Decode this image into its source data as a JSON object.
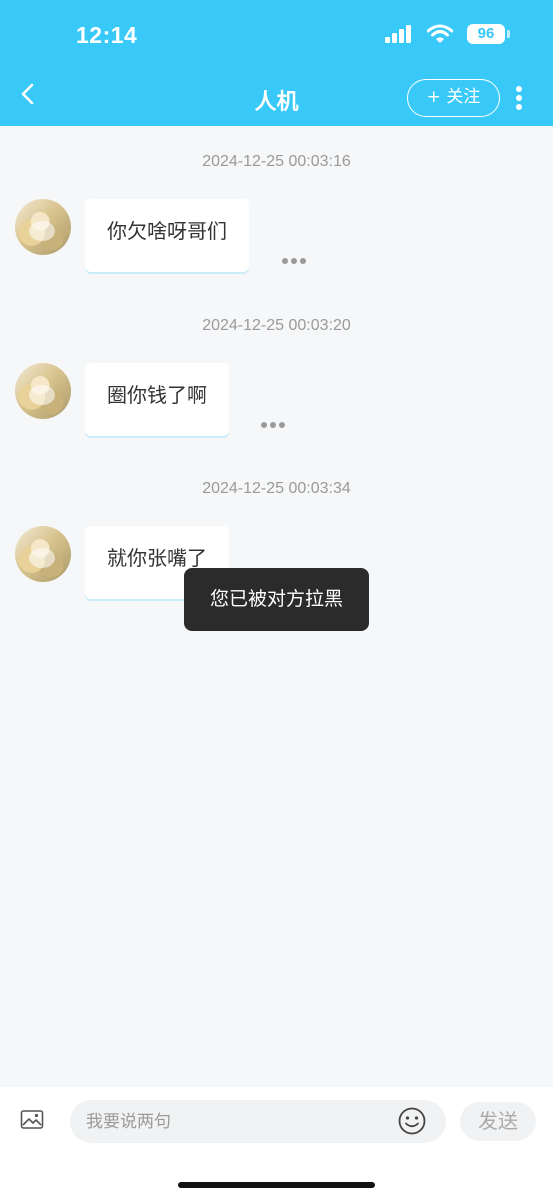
{
  "status_bar": {
    "time": "12:14",
    "battery": "96"
  },
  "header": {
    "title": "人机",
    "follow_label": "+ 关注"
  },
  "messages": [
    {
      "timestamp": "2024-12-25 00:03:16",
      "text": "你欠啥呀哥们"
    },
    {
      "timestamp": "2024-12-25 00:03:20",
      "text": "圈你钱了啊"
    },
    {
      "timestamp": "2024-12-25 00:03:34",
      "text": "就你张嘴了"
    }
  ],
  "toast": "您已被对方拉黑",
  "input_bar": {
    "placeholder": "我要说两句",
    "send_label": "发送"
  },
  "colors": {
    "accent": "#38c9f8",
    "background": "#f6f7f8",
    "toast_bg": "#2b2b2b"
  }
}
